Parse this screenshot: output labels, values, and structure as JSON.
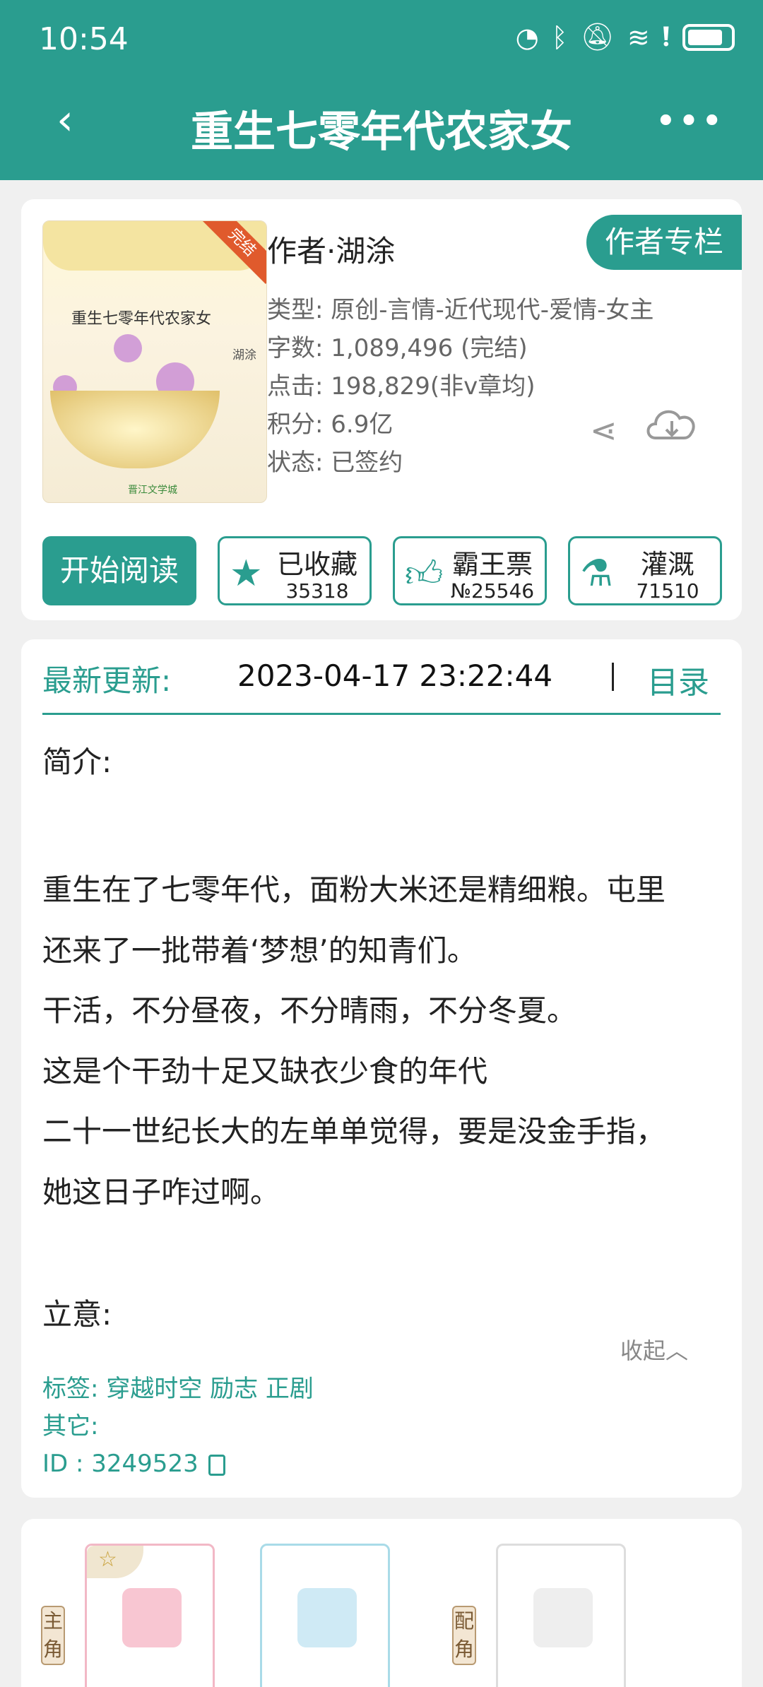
{
  "status_bar": {
    "time": "10:54"
  },
  "header": {
    "title": "重生七零年代农家女"
  },
  "book": {
    "cover": {
      "title": "重生七零年代农家女",
      "author": "湖涂",
      "badge": "完结",
      "publisher": "晋江文学城"
    },
    "author_line": "作者·湖涂",
    "author_column_label": "作者专栏",
    "meta": [
      "类型: 原创-言情-近代现代-爱情-女主",
      "字数: 1,089,496 (完结)",
      "点击: 198,829(非v章均)",
      "积分: 6.9亿",
      "状态: 已签约"
    ]
  },
  "actions": {
    "read_label": "开始阅读",
    "favorite": {
      "label": "已收藏",
      "count": "35318"
    },
    "ticket": {
      "label": "霸王票",
      "count": "№25546"
    },
    "irrigate": {
      "label": "灌溉",
      "count": "71510"
    }
  },
  "update": {
    "label": "最新更新:",
    "time": "2023-04-17 23:22:44",
    "catalog_label": "目录"
  },
  "intro": {
    "label": "简介:",
    "lines": [
      "重生在了七零年代，面粉大米还是精细粮。屯里",
      "还来了一批带着‘梦想’的知青们。",
      "干活，不分昼夜，不分晴雨，不分冬夏。",
      "这是个干劲十足又缺衣少食的年代",
      "二十一世纪长大的左单单觉得，要是没金手指，",
      "她这日子咋过啊。"
    ],
    "theme_label": "立意:",
    "collapse_label": "收起︿",
    "tags_line": "标签:  穿越时空 励志 正剧",
    "other_line": "其它:",
    "id_line": "ID    :  3249523"
  },
  "roles": {
    "main_label": "主角",
    "support_label": "配角"
  },
  "colors": {
    "accent": "#2a9d8f",
    "text": "#222222",
    "muted": "#666666"
  }
}
